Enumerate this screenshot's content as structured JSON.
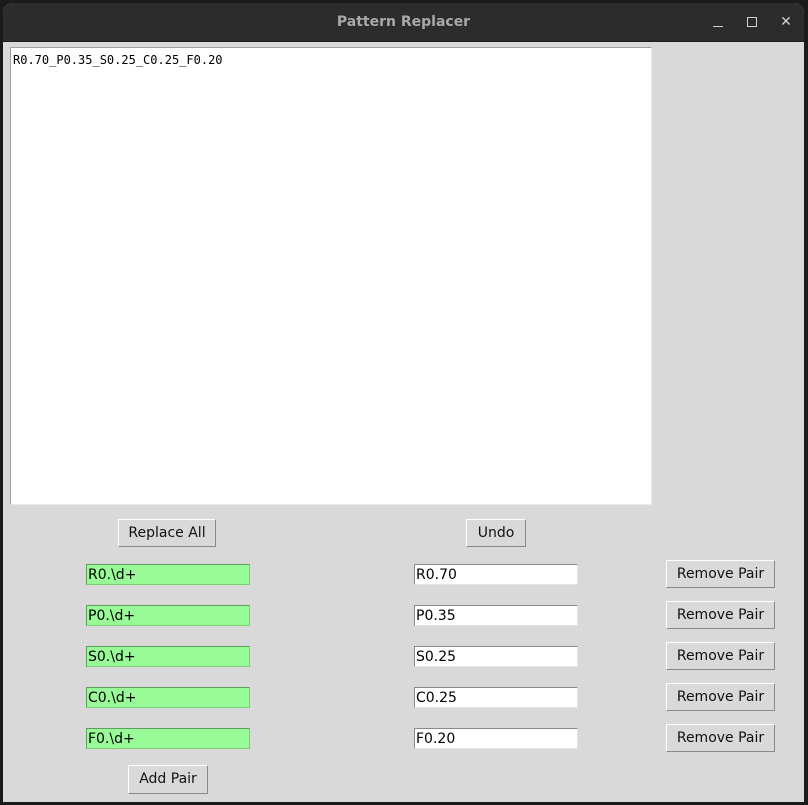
{
  "window": {
    "title": "Pattern Replacer",
    "controls": {
      "minimize": "minimize-icon",
      "maximize": "maximize-icon",
      "close": "close-icon"
    }
  },
  "editor": {
    "content": "R0.70_P0.35_S0.25_C0.25_F0.20"
  },
  "toolbar": {
    "replace_all_label": "Replace All",
    "undo_label": "Undo"
  },
  "pairs": [
    {
      "pattern": "R0.\\d+",
      "replacement": "R0.70",
      "remove_label": "Remove Pair"
    },
    {
      "pattern": "P0.\\d+",
      "replacement": "P0.35",
      "remove_label": "Remove Pair"
    },
    {
      "pattern": "S0.\\d+",
      "replacement": "S0.25",
      "remove_label": "Remove Pair"
    },
    {
      "pattern": "C0.\\d+",
      "replacement": "C0.25",
      "remove_label": "Remove Pair"
    },
    {
      "pattern": "F0.\\d+",
      "replacement": "F0.20",
      "remove_label": "Remove Pair"
    }
  ],
  "add_pair_label": "Add Pair",
  "colors": {
    "pattern_field_bg": "#98fb98",
    "window_bg": "#d9d9d9",
    "titlebar_bg": "#2c2c2c"
  }
}
